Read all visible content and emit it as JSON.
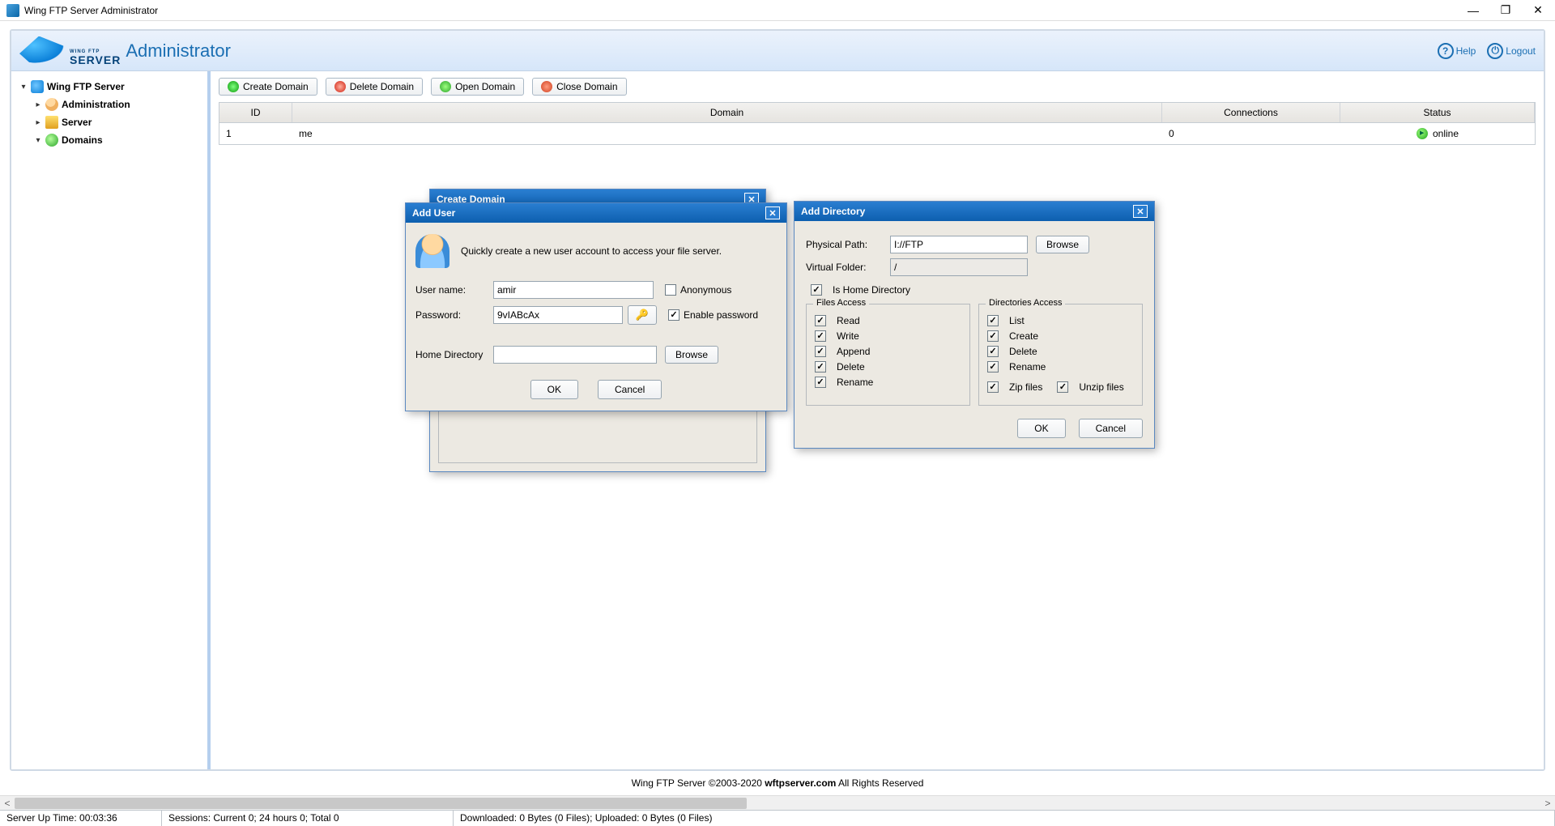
{
  "window": {
    "title": "Wing FTP Server Administrator"
  },
  "banner": {
    "logo_small": "WING FTP",
    "logo_server": "SERVER",
    "title": "Administrator",
    "help": "Help",
    "logout": "Logout"
  },
  "tree": {
    "root": "Wing FTP Server",
    "administration": "Administration",
    "server": "Server",
    "domains": "Domains"
  },
  "toolbar": {
    "create_domain": "Create Domain",
    "delete_domain": "Delete Domain",
    "open_domain": "Open Domain",
    "close_domain": "Close Domain"
  },
  "grid": {
    "headers": {
      "id": "ID",
      "domain": "Domain",
      "connections": "Connections",
      "status": "Status"
    },
    "rows": [
      {
        "id": "1",
        "domain": "me",
        "connections": "0",
        "status": "online"
      }
    ]
  },
  "dlg_create_domain": {
    "title": "Create Domain"
  },
  "dlg_add_user": {
    "title": "Add User",
    "intro": "Quickly create a new user account to access your file server.",
    "username_label": "User name:",
    "username_value": "amir",
    "anonymous": "Anonymous",
    "password_label": "Password:",
    "password_value": "9vIABcAx",
    "enable_password": "Enable password",
    "home_label": "Home Directory",
    "home_value": "",
    "browse": "Browse",
    "ok": "OK",
    "cancel": "Cancel"
  },
  "dlg_add_dir": {
    "title": "Add Directory",
    "physical_label": "Physical Path:",
    "physical_value": "I://FTP",
    "browse": "Browse",
    "virtual_label": "Virtual Folder:",
    "virtual_value": "/",
    "is_home": "Is Home Directory",
    "files_legend": "Files Access",
    "dirs_legend": "Directories Access",
    "perms_files": [
      "Read",
      "Write",
      "Append",
      "Delete",
      "Rename"
    ],
    "perms_dirs": [
      "List",
      "Create",
      "Delete",
      "Rename"
    ],
    "zip": "Zip files",
    "unzip": "Unzip files",
    "ok": "OK",
    "cancel": "Cancel"
  },
  "footer": {
    "text_pre": "Wing FTP Server ©2003-2020 ",
    "link": "wftpserver.com",
    "text_post": " All Rights Reserved"
  },
  "status": {
    "uptime": "Server Up Time: 00:03:36",
    "sessions": "Sessions: Current 0;  24 hours 0;  Total 0",
    "transfer": "Downloaded: 0 Bytes (0 Files);  Uploaded: 0 Bytes (0 Files)"
  }
}
